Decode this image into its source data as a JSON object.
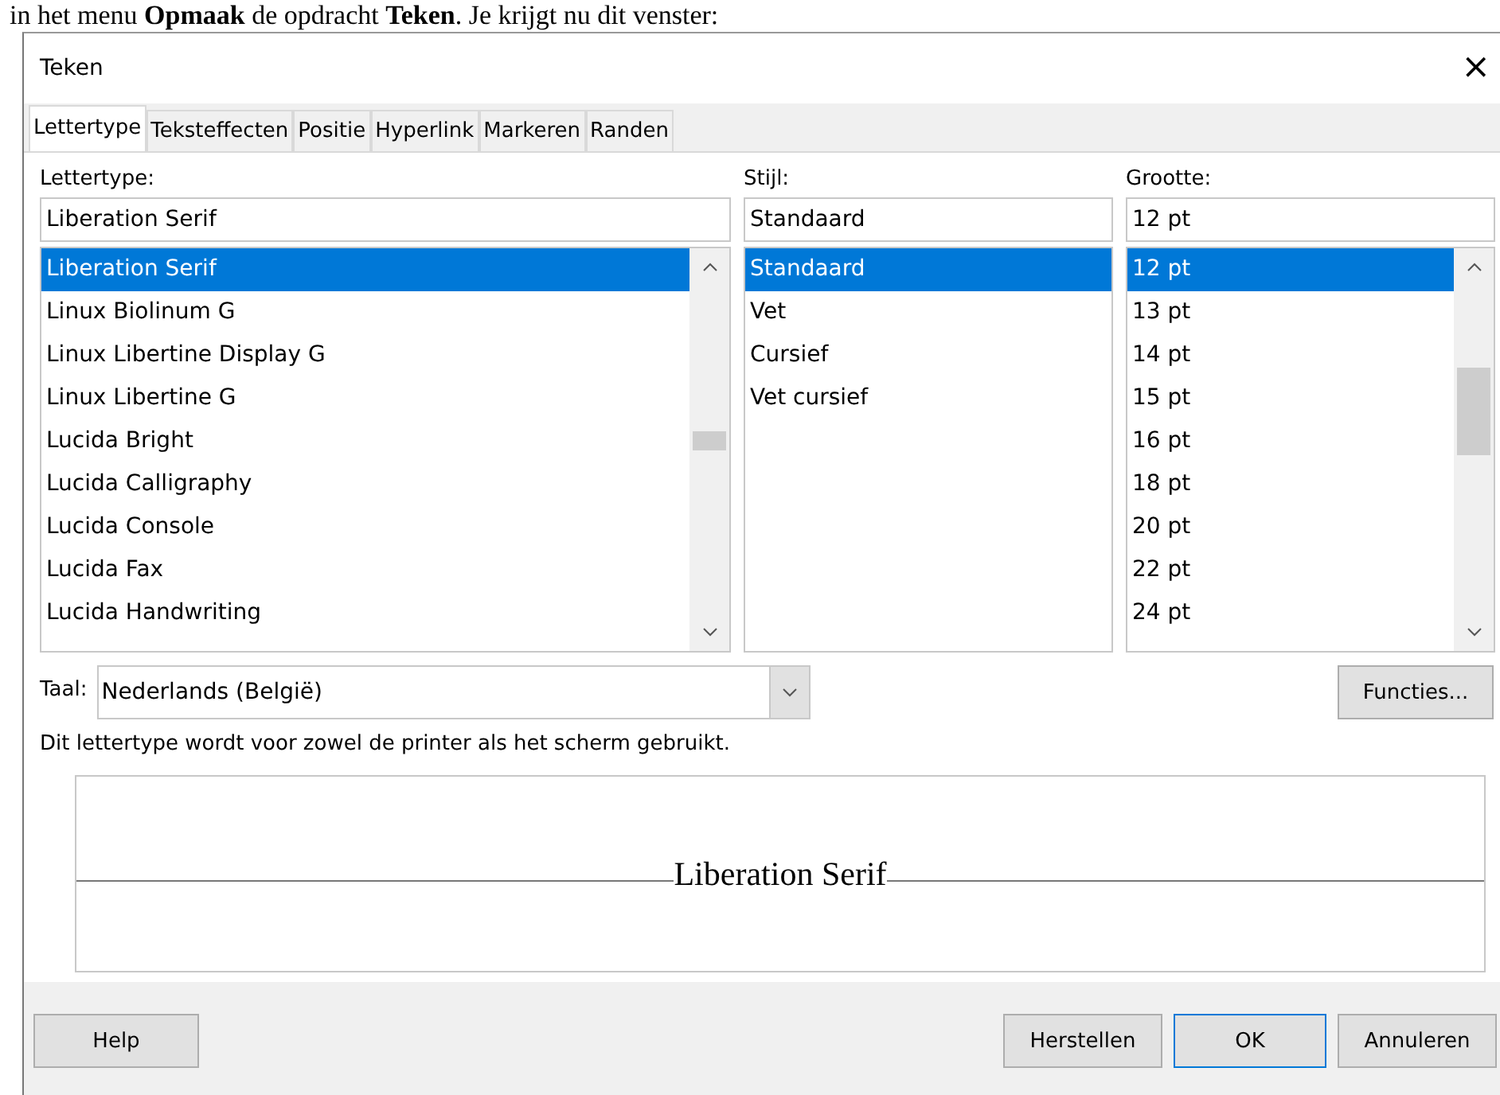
{
  "intro_text": "in het menu **Opmaak** de opdracht **Teken**. Je krijgt nu dit venster:",
  "window": {
    "title": "Teken",
    "close_label": "×"
  },
  "tabs": [
    {
      "label": "Lettertype",
      "selected": true
    },
    {
      "label": "Teksteffecten",
      "selected": false
    },
    {
      "label": "Positie",
      "selected": false
    },
    {
      "label": "Hyperlink",
      "selected": false
    },
    {
      "label": "Markeren",
      "selected": false
    },
    {
      "label": "Randen",
      "selected": false
    }
  ],
  "columns": [
    {
      "label": "Lettertype:",
      "value": "Liberation Serif",
      "scrollbar": true,
      "items": [
        {
          "label": "Liberation Serif",
          "selected": true
        },
        {
          "label": "Linux Biolinum G",
          "selected": false
        },
        {
          "label": "Linux Libertine Display G",
          "selected": false
        },
        {
          "label": "Linux Libertine G",
          "selected": false
        },
        {
          "label": "Lucida Bright",
          "selected": false
        },
        {
          "label": "Lucida Calligraphy",
          "selected": false
        },
        {
          "label": "Lucida Console",
          "selected": false
        },
        {
          "label": "Lucida Fax",
          "selected": false
        },
        {
          "label": "Lucida Handwriting",
          "selected": false
        }
      ]
    },
    {
      "label": "Stijl:",
      "value": "Standaard",
      "scrollbar": false,
      "items": [
        {
          "label": "Standaard",
          "selected": true
        },
        {
          "label": "Vet",
          "selected": false
        },
        {
          "label": "Cursief",
          "selected": false
        },
        {
          "label": "Vet cursief",
          "selected": false
        }
      ]
    },
    {
      "label": "Grootte:",
      "value": "12 pt",
      "scrollbar": true,
      "items": [
        {
          "label": "12 pt",
          "selected": true
        },
        {
          "label": "13 pt",
          "selected": false
        },
        {
          "label": "14 pt",
          "selected": false
        },
        {
          "label": "15 pt",
          "selected": false
        },
        {
          "label": "16 pt",
          "selected": false
        },
        {
          "label": "18 pt",
          "selected": false
        },
        {
          "label": "20 pt",
          "selected": false
        },
        {
          "label": "22 pt",
          "selected": false
        },
        {
          "label": "24 pt",
          "selected": false
        }
      ]
    }
  ],
  "language": {
    "label": "Taal:",
    "value": "Nederlands (België)"
  },
  "features_button": "Functies...",
  "description": "Dit lettertype wordt voor zowel de printer als het scherm gebruikt.",
  "preview": {
    "text": "Liberation Serif"
  },
  "buttons": [
    {
      "label": "Help",
      "kind": "help"
    },
    {
      "label": "Herstellen",
      "kind": "normal"
    },
    {
      "label": "OK",
      "kind": "default"
    },
    {
      "label": "Annuleren",
      "kind": "normal"
    }
  ]
}
